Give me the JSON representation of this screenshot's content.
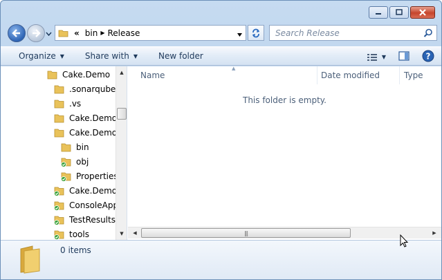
{
  "window": {
    "caption_buttons": [
      "minimize",
      "maximize",
      "close"
    ]
  },
  "navigation": {
    "back_icon": "back-arrow-icon",
    "forward_icon": "forward-arrow-icon",
    "address_overflow": "«",
    "address_segments": [
      "bin",
      "Release"
    ],
    "search_placeholder": "Search Release"
  },
  "toolbar": {
    "organize": "Organize",
    "share_with": "Share with",
    "new_folder": "New folder"
  },
  "tree": {
    "items": [
      {
        "label": "Cake.Demo",
        "icon": "folder-icon",
        "check": false
      },
      {
        "label": ".sonarqube",
        "icon": "folder-icon",
        "check": false
      },
      {
        "label": ".vs",
        "icon": "folder-icon",
        "check": false
      },
      {
        "label": "Cake.Demo.I",
        "icon": "folder-icon",
        "check": false
      },
      {
        "label": "Cake.Demo.(",
        "icon": "folder-icon",
        "check": false
      },
      {
        "label": "bin",
        "icon": "folder-icon",
        "check": false
      },
      {
        "label": "obj",
        "icon": "folder-check-icon",
        "check": true
      },
      {
        "label": "Properties",
        "icon": "folder-check-icon",
        "check": true
      },
      {
        "label": "Cake.Demo.S",
        "icon": "folder-check-icon",
        "check": true
      },
      {
        "label": "ConsoleApp",
        "icon": "folder-check-icon",
        "check": true
      },
      {
        "label": "TestResults",
        "icon": "folder-check-icon",
        "check": true
      },
      {
        "label": "tools",
        "icon": "folder-check-icon",
        "check": true
      }
    ]
  },
  "columns": {
    "name": "Name",
    "date_modified": "Date modified",
    "type": "Type"
  },
  "file_list": {
    "empty_message": "This folder is empty."
  },
  "details": {
    "item_count": "0 items"
  },
  "colors": {
    "window_frame": "#bcd3ec",
    "toolbar": "#dfe9f5",
    "folder": "#e9c25a"
  }
}
